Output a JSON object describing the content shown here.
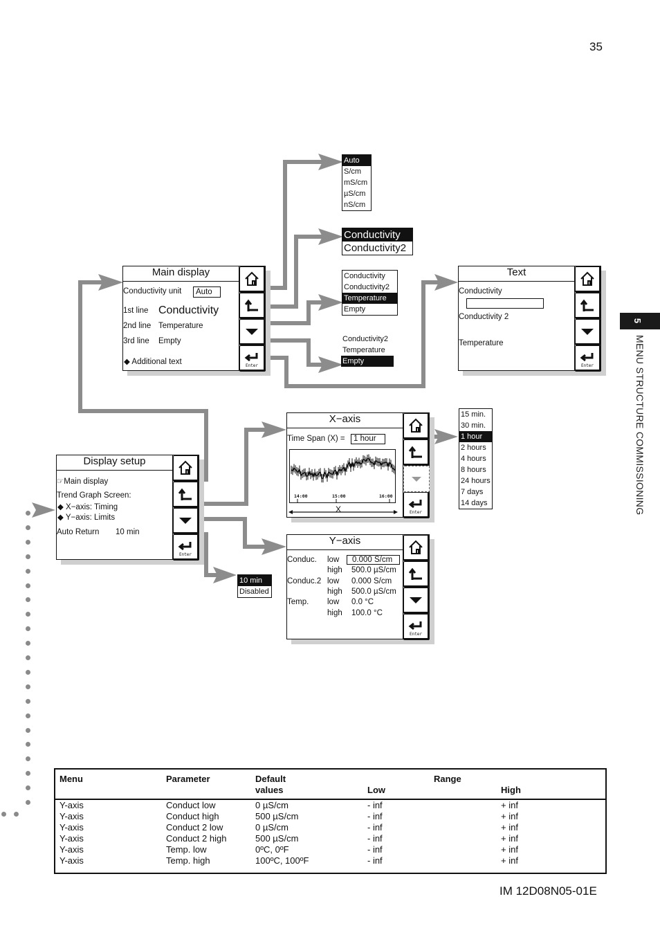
{
  "page": {
    "number": "35",
    "footer_code": "IM 12D08N05-01E",
    "section_number": "5",
    "section_title": "MENU STRUCTURE COMMISSIONING"
  },
  "colors": {
    "connector": "#8c8c8c",
    "selected_bg": "#111111",
    "shadow": "#cfcfcf"
  },
  "screens": {
    "main_display": {
      "title": "Main display",
      "unit_label": "Conductivity unit",
      "unit_value": "Auto",
      "line1_label": "1st line",
      "line1_value": "Conductivity",
      "line2_label": "2nd line",
      "line2_value": "Temperature",
      "line3_label": "3rd line",
      "line3_value": "Empty",
      "additional": "◆ Additional text"
    },
    "text": {
      "title": "Text",
      "field1_label": "Conductivity",
      "field1_value": "",
      "field2_label": "Conductivity 2",
      "field3_label": "Temperature"
    },
    "display_setup": {
      "title": "Display setup",
      "main_display": "☞Main display",
      "trend_label": "Trend Graph Screen:",
      "x_axis": "◆ X−axis: Timing",
      "y_axis": "◆ Y−axis: Limits",
      "auto_return_label": "Auto Return",
      "auto_return_value": "10 min"
    },
    "x_axis": {
      "title": "X−axis",
      "span_label": "Time Span (X) =",
      "span_value": "1 hour",
      "graph_ticks": [
        "14:00",
        "15:00",
        "16:00"
      ],
      "axis_label": "X"
    },
    "y_axis": {
      "title": "Y−axis",
      "rows": [
        {
          "group": "Conduc.",
          "bound": "low",
          "value": "0.000 S/cm"
        },
        {
          "group": "",
          "bound": "high",
          "value": "500.0 µS/cm"
        },
        {
          "group": "Conduc.2",
          "bound": "low",
          "value": "0.000 S/cm"
        },
        {
          "group": "",
          "bound": "high",
          "value": "500.0 µS/cm"
        },
        {
          "group": "Temp.",
          "bound": "low",
          "value": "0.0 °C"
        },
        {
          "group": "",
          "bound": "high",
          "value": "100.0 °C"
        }
      ]
    },
    "buttons": {
      "home": "home",
      "back": "back",
      "down": "down",
      "enter": "Enter"
    }
  },
  "lists": {
    "unit_options": {
      "items": [
        "Auto",
        "S/cm",
        "mS/cm",
        "µS/cm",
        "nS/cm"
      ],
      "selected": 0
    },
    "line1_options": {
      "items": [
        "Conductivity",
        "Conductivity2"
      ],
      "selected": 0
    },
    "line2_options": {
      "items": [
        "Conductivity",
        "Conductivity2",
        "Temperature",
        "Empty"
      ],
      "selected": 2
    },
    "line3_options": {
      "items": [
        "Conductivity2",
        "Temperature",
        "Empty"
      ],
      "selected": 2
    },
    "timespan_options": {
      "items": [
        "15 min.",
        "30 min.",
        "1 hour",
        "2 hours",
        "4 hours",
        "8 hours",
        "24 hours",
        "7 days",
        "14 days"
      ],
      "selected": 2
    },
    "autoreturn_options": {
      "items": [
        "10 min",
        "Disabled"
      ],
      "selected": 0
    }
  },
  "table": {
    "headers": {
      "menu": "Menu",
      "parameter": "Parameter",
      "default_1": "Default",
      "default_2": "values",
      "range": "Range",
      "low": "Low",
      "high": "High"
    },
    "rows": [
      {
        "menu": "Y-axis",
        "parameter": "Conduct low",
        "default": "0 µS/cm",
        "low": "- inf",
        "high": "+ inf"
      },
      {
        "menu": "Y-axis",
        "parameter": "Conduct high",
        "default": "500 µS/cm",
        "low": "- inf",
        "high": "+ inf"
      },
      {
        "menu": "Y-axis",
        "parameter": "Conduct 2 low",
        "default": "0 µS/cm",
        "low": "- inf",
        "high": "+ inf"
      },
      {
        "menu": "Y-axis",
        "parameter": "Conduct 2 high",
        "default": "500 µS/cm",
        "low": "- inf",
        "high": "+ inf"
      },
      {
        "menu": "Y-axis",
        "parameter": "Temp. low",
        "default": "0ºC, 0ºF",
        "low": "- inf",
        "high": "+ inf"
      },
      {
        "menu": "Y-axis",
        "parameter": "Temp. high",
        "default": "100ºC, 100ºF",
        "low": "- inf",
        "high": "+ inf"
      }
    ]
  }
}
